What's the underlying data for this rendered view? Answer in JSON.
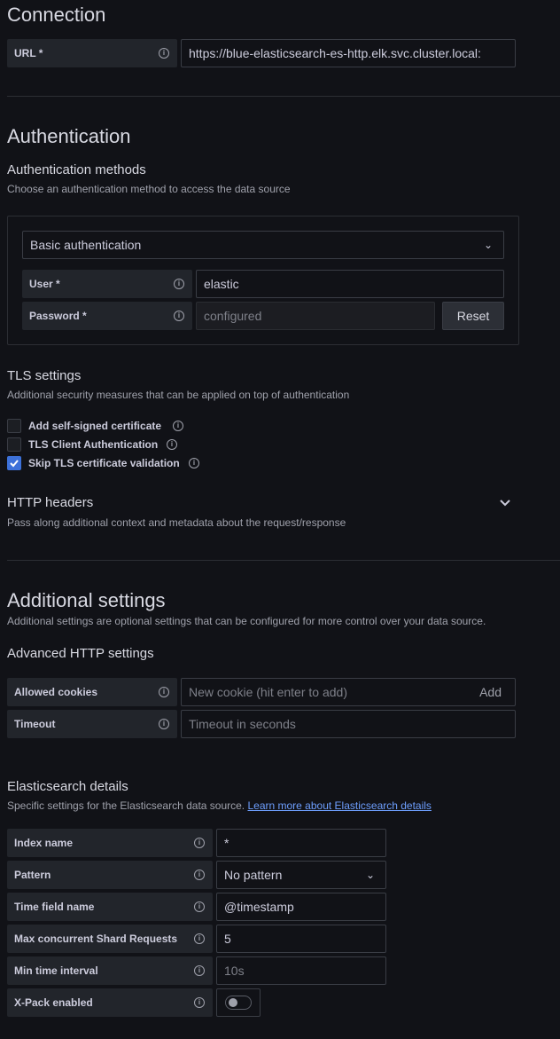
{
  "connection": {
    "title": "Connection",
    "url_label": "URL *",
    "url_value": "https://blue-elasticsearch-es-http.elk.svc.cluster.local:"
  },
  "auth": {
    "title": "Authentication",
    "methods_title": "Authentication methods",
    "methods_desc": "Choose an authentication method to access the data source",
    "method_selected": "Basic authentication",
    "user_label": "User *",
    "user_value": "elastic",
    "password_label": "Password *",
    "password_value": "configured",
    "reset_label": "Reset"
  },
  "tls": {
    "title": "TLS settings",
    "desc": "Additional security measures that can be applied on top of authentication",
    "options": [
      {
        "label": "Add self-signed certificate",
        "checked": false
      },
      {
        "label": "TLS Client Authentication",
        "checked": false
      },
      {
        "label": "Skip TLS certificate validation",
        "checked": true
      }
    ]
  },
  "http_headers": {
    "title": "HTTP headers",
    "desc": "Pass along additional context and metadata about the request/response"
  },
  "additional": {
    "title": "Additional settings",
    "desc": "Additional settings are optional settings that can be configured for more control over your data source.",
    "advanced_title": "Advanced HTTP settings",
    "cookies_label": "Allowed cookies",
    "cookies_placeholder": "New cookie (hit enter to add)",
    "cookies_add": "Add",
    "timeout_label": "Timeout",
    "timeout_placeholder": "Timeout in seconds"
  },
  "es": {
    "title": "Elasticsearch details",
    "desc": "Specific settings for the Elasticsearch data source.",
    "link": "Learn more about Elasticsearch details",
    "index_label": "Index name",
    "index_value": "*",
    "pattern_label": "Pattern",
    "pattern_value": "No pattern",
    "time_field_label": "Time field name",
    "time_field_value": "@timestamp",
    "max_shard_label": "Max concurrent Shard Requests",
    "max_shard_value": "5",
    "min_interval_label": "Min time interval",
    "min_interval_placeholder": "10s",
    "xpack_label": "X-Pack enabled",
    "xpack_enabled": false
  },
  "icons": {
    "info": "info-icon",
    "chevron": "chevron-down-icon",
    "check": "check-icon"
  }
}
